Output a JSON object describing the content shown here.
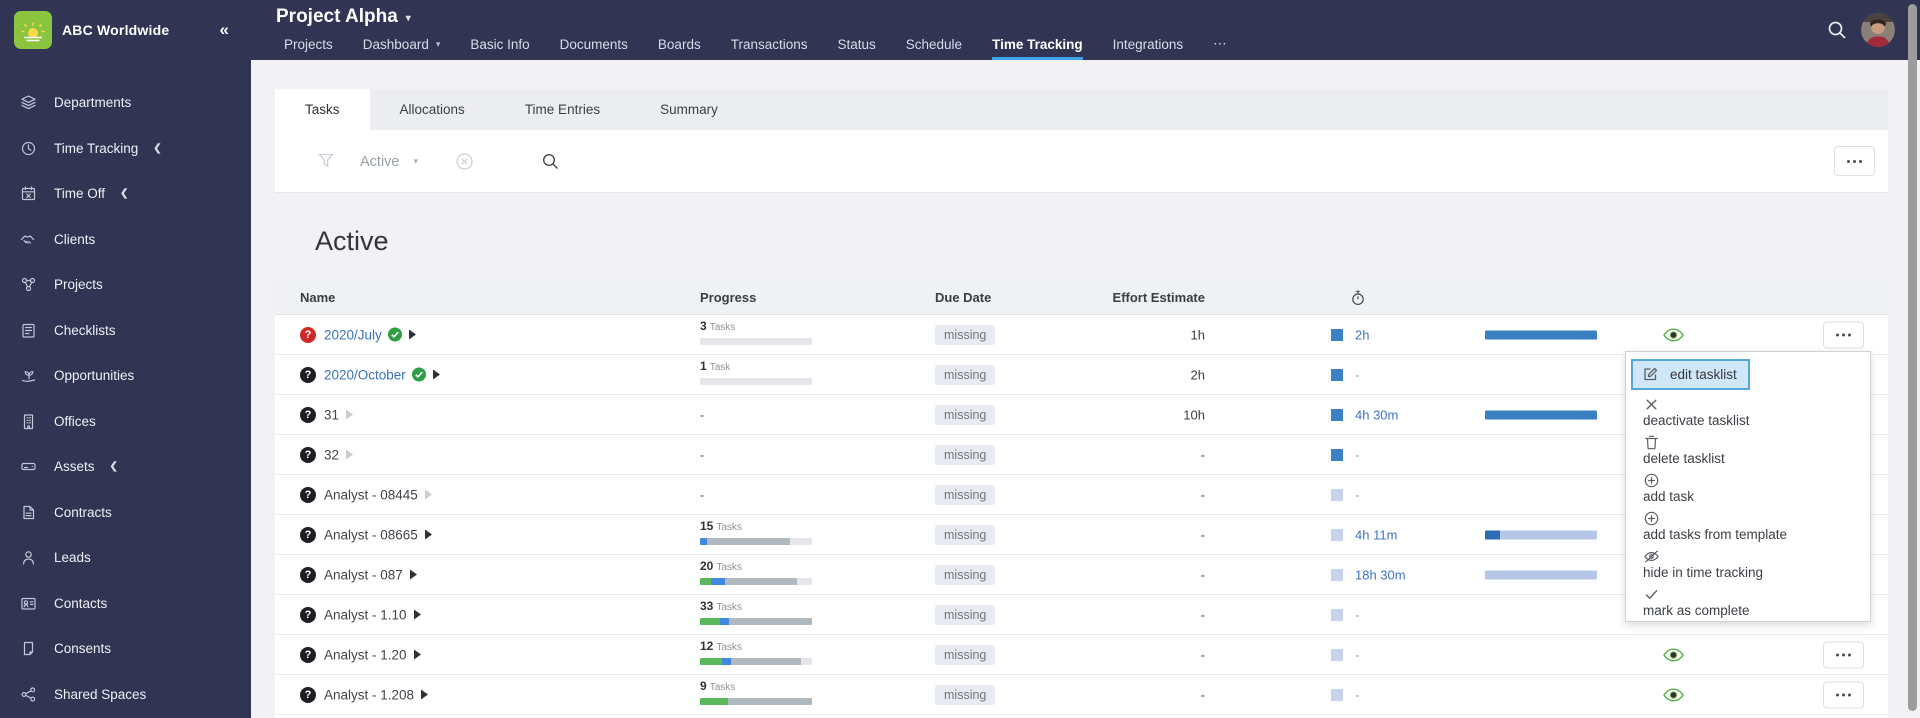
{
  "colors": {
    "navy": "#313452",
    "accent_underline": "#3da2ea",
    "link_blue": "#3a72b8",
    "brand_green": "#8bc53f",
    "progress": {
      "green": "#5cb85c",
      "blue": "#4189e0",
      "slate": "#b0b8c0",
      "light": "#e5e6e9"
    },
    "logged_bar": {
      "blue": "#3a7fc2",
      "darkblue": "#2e6cb3",
      "peri": "#b4c7e7"
    },
    "square": {
      "solid": "#3b82c8",
      "light": "#c6d3eb"
    },
    "pill_bg": "#e9ebf4",
    "menu_highlight_bg": "#cfe7f8",
    "menu_highlight_border": "#53a7da",
    "eye_green": "#55ad4a",
    "badge_red": "#cf2828",
    "badge_dark": "#1d1f24",
    "check_green": "#2f9e44"
  },
  "topbar": {
    "company": "ABC Worldwide",
    "collapse_icon": "«",
    "title": "Project Alpha",
    "title_caret": "▾",
    "nav": [
      {
        "label": "Projects",
        "caret": false,
        "active": false
      },
      {
        "label": "Dashboard",
        "caret": true,
        "active": false
      },
      {
        "label": "Basic Info",
        "caret": false,
        "active": false
      },
      {
        "label": "Documents",
        "caret": false,
        "active": false
      },
      {
        "label": "Boards",
        "caret": false,
        "active": false
      },
      {
        "label": "Transactions",
        "caret": false,
        "active": false
      },
      {
        "label": "Status",
        "caret": false,
        "active": false
      },
      {
        "label": "Schedule",
        "caret": false,
        "active": false
      },
      {
        "label": "Time Tracking",
        "caret": false,
        "active": true
      },
      {
        "label": "Integrations",
        "caret": false,
        "active": false
      },
      {
        "label": "⋯",
        "caret": false,
        "active": false
      }
    ],
    "icons": [
      "search-icon",
      "avatar"
    ]
  },
  "sidebar": {
    "items": [
      {
        "label": "Departments",
        "icon": "layers",
        "chevron": false
      },
      {
        "label": "Time Tracking",
        "icon": "clock",
        "chevron": true
      },
      {
        "label": "Time Off",
        "icon": "calendar-x",
        "chevron": true
      },
      {
        "label": "Clients",
        "icon": "handshake",
        "chevron": false
      },
      {
        "label": "Projects",
        "icon": "network",
        "chevron": false
      },
      {
        "label": "Checklists",
        "icon": "checklist",
        "chevron": false
      },
      {
        "label": "Opportunities",
        "icon": "sprout",
        "chevron": false
      },
      {
        "label": "Offices",
        "icon": "building",
        "chevron": false
      },
      {
        "label": "Assets",
        "icon": "drive",
        "chevron": true
      },
      {
        "label": "Contracts",
        "icon": "contract",
        "chevron": false
      },
      {
        "label": "Leads",
        "icon": "person",
        "chevron": false
      },
      {
        "label": "Contacts",
        "icon": "idcard",
        "chevron": false
      },
      {
        "label": "Consents",
        "icon": "docpage",
        "chevron": false
      },
      {
        "label": "Shared Spaces",
        "icon": "share",
        "chevron": false
      }
    ]
  },
  "subtabs": {
    "items": [
      "Tasks",
      "Allocations",
      "Time Entries",
      "Summary"
    ],
    "active": "Tasks"
  },
  "filterbar": {
    "filter_value": "Active",
    "icons": [
      "funnel-icon",
      "clear-filter-icon",
      "search-icon",
      "table-options-button"
    ]
  },
  "section_heading": "Active",
  "table": {
    "columns": {
      "name": "Name",
      "progress": "Progress",
      "due": "Due Date",
      "effort": "Effort Estimate",
      "timer": "stopwatch-icon"
    },
    "rows": [
      {
        "name": "2020/July",
        "status": "red-question",
        "link": true,
        "check": true,
        "arrow": "solid",
        "tasks": "3",
        "tasks_unit": "Tasks",
        "progress": [
          [
            "light",
            100
          ]
        ],
        "due": "missing",
        "effort": "1h",
        "square": "solid",
        "logged": "2h",
        "bar": [
          [
            "blue",
            100
          ]
        ],
        "eye": true,
        "menu": true
      },
      {
        "name": "2020/October",
        "status": "question",
        "link": true,
        "check": true,
        "arrow": "solid",
        "tasks": "1",
        "tasks_unit": "Task",
        "progress": [
          [
            "light",
            100
          ]
        ],
        "due": "missing",
        "effort": "2h",
        "square": "solid",
        "logged": "-",
        "bar": null,
        "eye": false,
        "menu": false
      },
      {
        "name": "31",
        "status": "question",
        "link": false,
        "check": false,
        "arrow": "muted",
        "tasks": null,
        "tasks_unit": null,
        "progress": null,
        "due": "missing",
        "effort": "10h",
        "square": "solid",
        "logged": "4h 30m",
        "bar": [
          [
            "blue",
            100
          ]
        ],
        "eye": false,
        "menu": false
      },
      {
        "name": "32",
        "status": "question",
        "link": false,
        "check": false,
        "arrow": "muted",
        "tasks": null,
        "tasks_unit": null,
        "progress": null,
        "due": "missing",
        "effort": "-",
        "square": "solid",
        "logged": "-",
        "bar": null,
        "eye": false,
        "menu": false
      },
      {
        "name": "Analyst - 08445",
        "status": "question",
        "link": false,
        "check": false,
        "arrow": "muted",
        "tasks": null,
        "tasks_unit": null,
        "progress": null,
        "due": "missing",
        "effort": "-",
        "square": "light",
        "logged": "-",
        "bar": null,
        "eye": false,
        "menu": false
      },
      {
        "name": "Analyst - 08665",
        "status": "question",
        "link": false,
        "check": false,
        "arrow": "solid",
        "tasks": "15",
        "tasks_unit": "Tasks",
        "progress": [
          [
            "blue",
            6
          ],
          [
            "slate",
            74
          ],
          [
            "light",
            20
          ]
        ],
        "due": "missing",
        "effort": "-",
        "square": "light",
        "logged": "4h 11m",
        "bar": [
          [
            "darkblue",
            13
          ],
          [
            "peri",
            87
          ]
        ],
        "eye": false,
        "menu": false
      },
      {
        "name": "Analyst - 087",
        "status": "question",
        "link": false,
        "check": false,
        "arrow": "solid",
        "tasks": "20",
        "tasks_unit": "Tasks",
        "progress": [
          [
            "green",
            10
          ],
          [
            "blue",
            12
          ],
          [
            "slate",
            65
          ],
          [
            "light",
            13
          ]
        ],
        "due": "missing",
        "effort": "-",
        "square": "light",
        "logged": "18h 30m",
        "bar": [
          [
            "peri",
            100
          ]
        ],
        "eye": false,
        "menu": false
      },
      {
        "name": "Analyst - 1.10",
        "status": "question",
        "link": false,
        "check": false,
        "arrow": "solid",
        "tasks": "33",
        "tasks_unit": "Tasks",
        "progress": [
          [
            "green",
            18
          ],
          [
            "blue",
            8
          ],
          [
            "slate",
            74
          ]
        ],
        "due": "missing",
        "effort": "-",
        "square": "light",
        "logged": "-",
        "bar": null,
        "eye": false,
        "menu": false
      },
      {
        "name": "Analyst - 1.20",
        "status": "question",
        "link": false,
        "check": false,
        "arrow": "solid",
        "tasks": "12",
        "tasks_unit": "Tasks",
        "progress": [
          [
            "green",
            20
          ],
          [
            "blue",
            8
          ],
          [
            "slate",
            62
          ],
          [
            "light",
            10
          ]
        ],
        "due": "missing",
        "effort": "-",
        "square": "light",
        "logged": "-",
        "bar": null,
        "eye": true,
        "menu": true
      },
      {
        "name": "Analyst - 1.208",
        "status": "question",
        "link": false,
        "check": false,
        "arrow": "solid",
        "tasks": "9",
        "tasks_unit": "Tasks",
        "progress": [
          [
            "green",
            25
          ],
          [
            "slate",
            75
          ]
        ],
        "due": "missing",
        "effort": "-",
        "square": "light",
        "logged": "-",
        "bar": null,
        "eye": true,
        "menu": true
      }
    ]
  },
  "context_menu": {
    "items": [
      {
        "label": "edit tasklist",
        "icon": "edit",
        "highlighted": true
      },
      {
        "label": "deactivate tasklist",
        "icon": "x",
        "highlighted": false
      },
      {
        "label": "delete tasklist",
        "icon": "trash",
        "highlighted": false
      },
      {
        "label": "add task",
        "icon": "plus",
        "highlighted": false
      },
      {
        "label": "add tasks from template",
        "icon": "plus",
        "highlighted": false
      },
      {
        "label": "hide in time tracking",
        "icon": "eyeslash",
        "highlighted": false
      },
      {
        "label": "mark as complete",
        "icon": "check",
        "highlighted": false
      }
    ]
  }
}
